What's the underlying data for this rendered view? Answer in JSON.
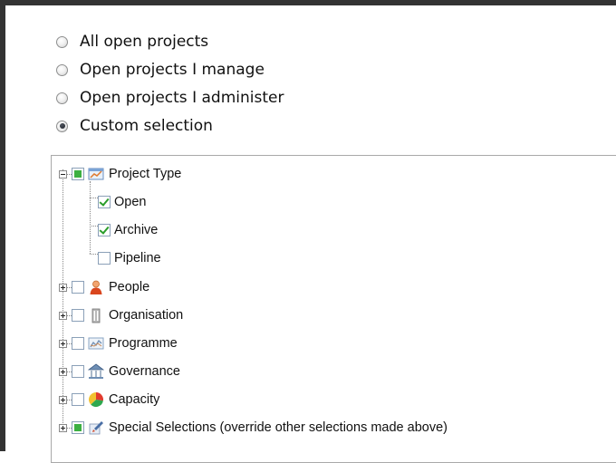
{
  "scope_options": [
    {
      "label": "All open projects",
      "selected": false
    },
    {
      "label": "Open projects I manage",
      "selected": false
    },
    {
      "label": "Open projects I administer",
      "selected": false
    },
    {
      "label": "Custom selection",
      "selected": true
    }
  ],
  "tree": {
    "project_type": {
      "label": "Project Type",
      "state": "partial",
      "expanded": true,
      "icon": "project-type-icon",
      "children": [
        {
          "label": "Open",
          "checked": true
        },
        {
          "label": "Archive",
          "checked": true
        },
        {
          "label": "Pipeline",
          "checked": false
        }
      ]
    },
    "nodes": [
      {
        "label": "People",
        "state": "unchecked",
        "icon": "people-icon"
      },
      {
        "label": "Organisation",
        "state": "unchecked",
        "icon": "organisation-icon"
      },
      {
        "label": "Programme",
        "state": "unchecked",
        "icon": "programme-icon"
      },
      {
        "label": "Governance",
        "state": "unchecked",
        "icon": "governance-icon"
      },
      {
        "label": "Capacity",
        "state": "unchecked",
        "icon": "capacity-icon"
      },
      {
        "label": "Special Selections (override other selections made above)",
        "state": "partial",
        "icon": "special-selections-icon"
      }
    ]
  },
  "colors": {
    "partial_fill": "#3cb042",
    "check_mark": "#2a9d2a",
    "panel_border": "#a9a9a9"
  }
}
